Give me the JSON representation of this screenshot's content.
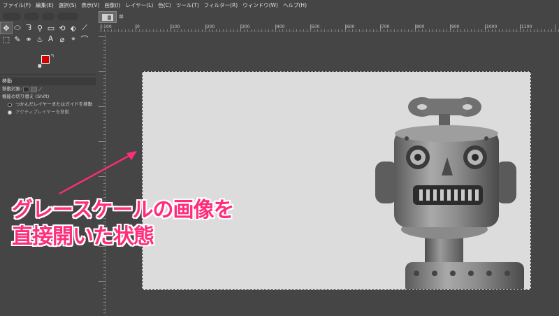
{
  "menubar": {
    "items": [
      "ファイル(F)",
      "編集(E)",
      "選択(S)",
      "表示(V)",
      "画像(I)",
      "レイヤー(L)",
      "色(C)",
      "ツール(T)",
      "フィルター(R)",
      "ウィンドウ(W)",
      "ヘルプ(H)"
    ]
  },
  "image_tab": {
    "close": "⊠"
  },
  "toolbox": {
    "row1": [
      "✥",
      "⬭",
      "ᘊ",
      "⚲",
      "▭",
      "⟲",
      "⬖",
      "⟋"
    ],
    "row2": [
      "⬚",
      "✎",
      "⚭",
      "♨",
      "Ꭺ",
      "⌀",
      "⌖",
      "⌒"
    ]
  },
  "colors": {
    "foreground": "#d40000",
    "background": "#ffffff"
  },
  "tool_options": {
    "title": "移動",
    "target_label": "移動対象:",
    "toggle_label": "機能の切り替え (Shift)",
    "option1": "つかんだレイヤーまたはガイドを移動",
    "option2": "アクティブレイヤーを移動"
  },
  "ruler": {
    "top_labels": [
      "|-100",
      "|0",
      "|100",
      "|200",
      "|300",
      "|400",
      "|500",
      "|600",
      "|700",
      "|800",
      "|900",
      "|1000",
      "|1100"
    ]
  },
  "annotation": {
    "line1": "グレースケールの画像を",
    "line2": "直接開いた状態",
    "color": "#ff2d7a"
  }
}
